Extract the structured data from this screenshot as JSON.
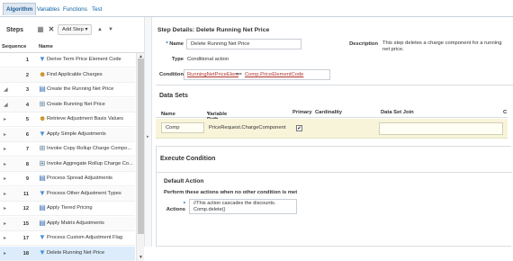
{
  "tabs": [
    "Algorithm",
    "Variables",
    "Functions",
    "Test"
  ],
  "steps": {
    "title": "Steps",
    "add_label": "Add Step ▾",
    "col_sequence": "Sequence",
    "col_name": "Name",
    "rows": [
      {
        "exp": "",
        "seq": "1",
        "icon": "filter-icon",
        "name": "Derive Term Price Element Code"
      },
      {
        "exp": "",
        "seq": "2",
        "icon": "person-icon",
        "name": "Find Applicable Charges"
      },
      {
        "exp": "◢",
        "seq": "3",
        "icon": "table-icon",
        "name": "Create the Running Net Price"
      },
      {
        "exp": "◢",
        "seq": "4",
        "icon": "tree-icon",
        "name": "Create Running Net Price"
      },
      {
        "exp": "▸",
        "seq": "5",
        "icon": "person-icon",
        "name": "Retrieve Adjustment Basis Values"
      },
      {
        "exp": "▸",
        "seq": "6",
        "icon": "filter-icon",
        "name": "Apply Simple Adjustments"
      },
      {
        "exp": "▸",
        "seq": "7",
        "icon": "tree-icon",
        "name": "Invoke Copy Rollup Charge Compo..."
      },
      {
        "exp": "▸",
        "seq": "8",
        "icon": "tree-icon",
        "name": "Invoke Aggregate Rollup Charge Co..."
      },
      {
        "exp": "▸",
        "seq": "9",
        "icon": "table-icon",
        "name": "Process Spread Adjustments"
      },
      {
        "exp": "▸",
        "seq": "11",
        "icon": "filter-icon",
        "name": "Process Other Adjustment Types"
      },
      {
        "exp": "▸",
        "seq": "12",
        "icon": "table-icon",
        "name": "Apply Tiered Pricing"
      },
      {
        "exp": "▸",
        "seq": "15",
        "icon": "table-icon",
        "name": "Apply Matrix Adjustments"
      },
      {
        "exp": "▸",
        "seq": "17",
        "icon": "filter-icon",
        "name": "Process Custom Adjustment Flag"
      },
      {
        "exp": "▸",
        "seq": "18",
        "icon": "filter-icon",
        "name": "Delete Running Net Price"
      }
    ]
  },
  "details": {
    "title": "Step Details: Delete Running Net Price",
    "name_label": "Name",
    "name_value": "Delete Running Net Price",
    "description_label": "Description",
    "description_value": "This step deletes a charge component for a running net price.",
    "type_label": "Type",
    "type_value": "Conditional action",
    "condition_label": "Condition",
    "condition_left": "RunningNetPriceElem",
    "condition_op": "==",
    "condition_right": "Comp.PriceElementCode"
  },
  "datasets": {
    "title": "Data Sets",
    "col_name": "Name",
    "col_variable_path": "Variable Path",
    "col_primary": "Primary",
    "col_cardinality": "Cardinality",
    "col_dataset_join": "Data Set Join",
    "col_trailing": "C",
    "row_name": "Comp",
    "row_variable_path": "PriceRequest.ChargeComponent",
    "row_primary_checked": "✔"
  },
  "execute": {
    "title": "Execute Condition",
    "default_action_title": "Default Action",
    "perform_text": "Perform these actions when no other condition is met",
    "actions_label": "Actions",
    "actions_text": "//This action cascades the discounts.\nComp.delete()"
  }
}
